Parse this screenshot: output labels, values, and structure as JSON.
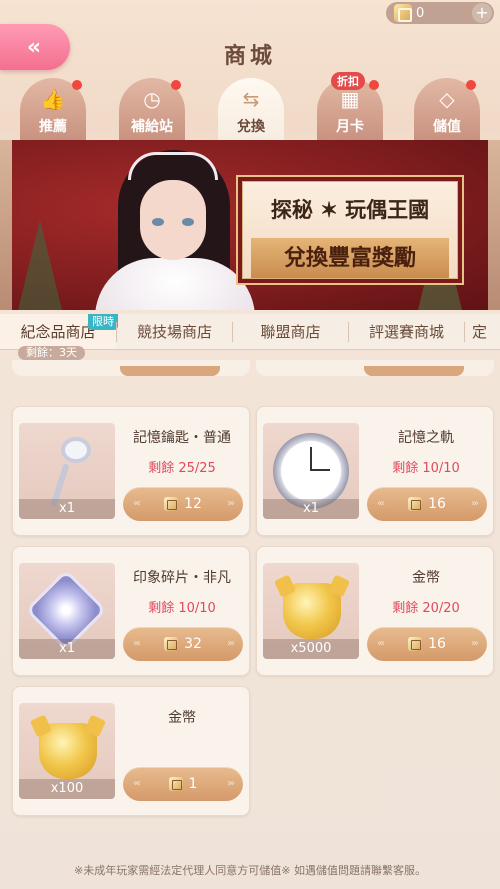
{
  "currency": {
    "value": "0",
    "icon": "gift-box-icon",
    "plus": "+"
  },
  "header": {
    "title": "商城",
    "back_glyph": "«"
  },
  "category_tabs": [
    {
      "label": "推薦",
      "icon": "thumbs-up-icon",
      "dot": true
    },
    {
      "label": "補給站",
      "icon": "clock-icon",
      "dot": true
    },
    {
      "label": "兌換",
      "icon": "exchange-icon",
      "active": true
    },
    {
      "label": "月卡",
      "icon": "calendar-icon",
      "tag": "折扣",
      "dot": true
    },
    {
      "label": "儲值",
      "icon": "diamond-icon",
      "dot": true
    }
  ],
  "banner": {
    "line1": "探秘 ✶ 玩偶王國",
    "line2": "兌換豐富獎勵"
  },
  "shop_tabs": [
    {
      "label": "紀念品商店",
      "active": true,
      "limit_tag": "限時",
      "remain": "剩餘：3天"
    },
    {
      "label": "競技場商店"
    },
    {
      "label": "聯盟商店"
    },
    {
      "label": "評選賽商城"
    },
    {
      "label": "定"
    }
  ],
  "items": [
    {
      "name": "記憶鑰匙・普通",
      "stock": "剩餘 25/25",
      "qty": "x1",
      "price": "12",
      "icon": "memory-key-icon"
    },
    {
      "name": "記憶之軌",
      "stock": "剩餘 10/10",
      "qty": "x1",
      "price": "16",
      "icon": "pocket-watch-icon"
    },
    {
      "name": "印象碎片・非凡",
      "stock": "剩餘 10/10",
      "qty": "x1",
      "price": "32",
      "icon": "crystal-shard-icon"
    },
    {
      "name": "金幣",
      "stock": "剩餘 20/20",
      "qty": "x5000",
      "price": "16",
      "icon": "gold-coin-icon"
    },
    {
      "name": "金幣",
      "stock": "",
      "qty": "x100",
      "price": "1",
      "icon": "gold-coin-icon"
    }
  ],
  "footer": {
    "notice": "※未成年玩家需經法定代理人同意方可儲值※ 如遇儲值問題請聯繫客服。"
  },
  "colors": {
    "accent_pink": "#f46f90",
    "stock_red": "#e04a5a",
    "button_tan": "#d49a6a"
  }
}
